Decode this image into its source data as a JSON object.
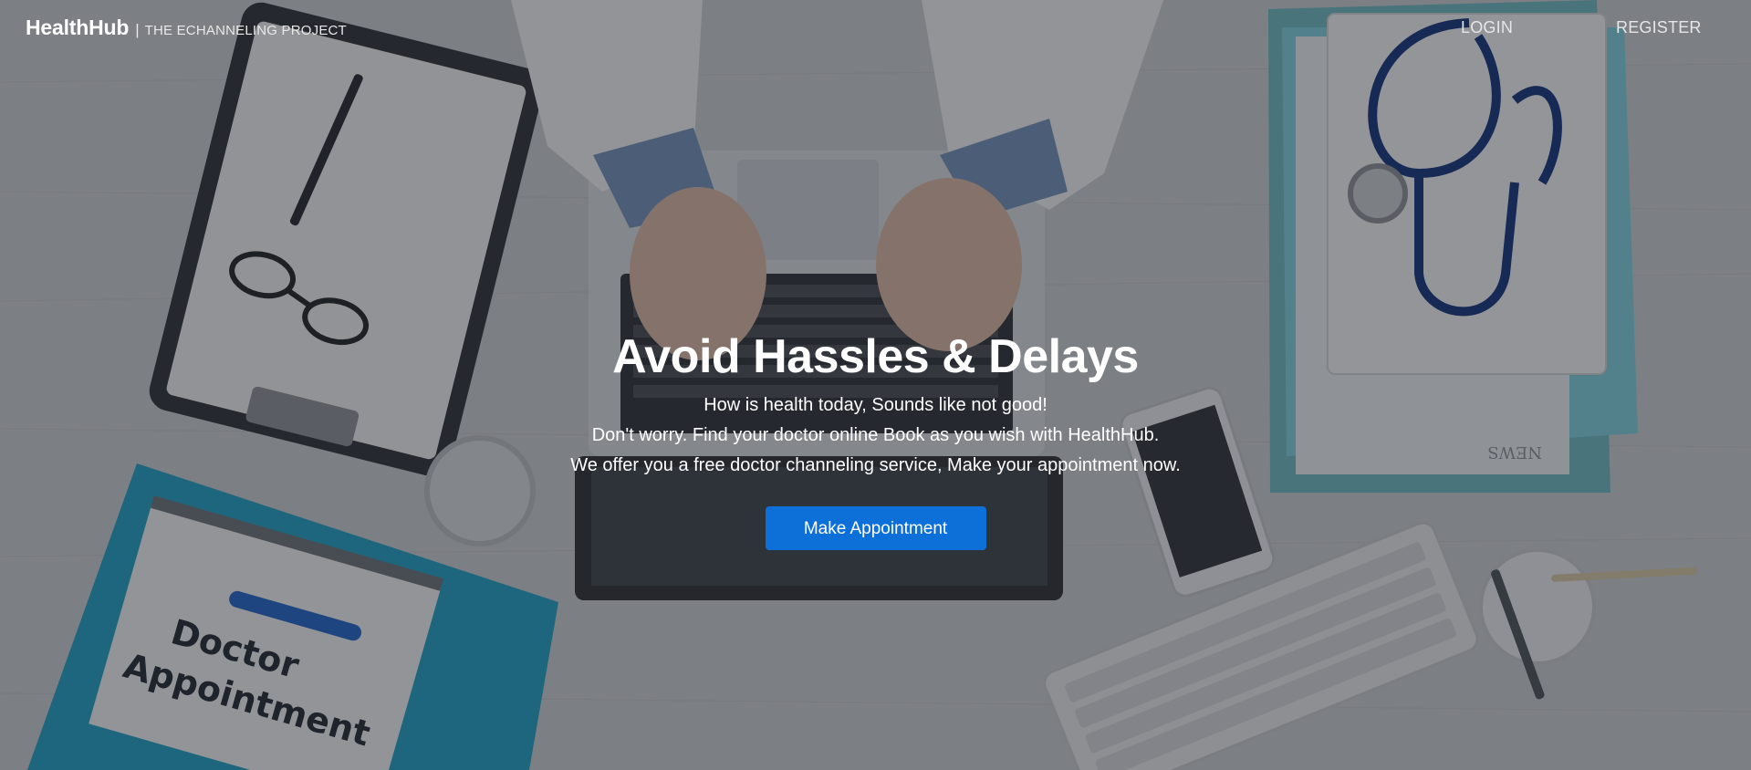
{
  "nav": {
    "brand_name": "HealthHub",
    "brand_separator": "|",
    "brand_tagline": "THE ECHANNELING PROJECT",
    "login_label": "LOGIN",
    "register_label": "REGISTER"
  },
  "hero": {
    "title": "Avoid Hassles & Delays",
    "lines": [
      "How is health today, Sounds like not good!",
      "Don't worry. Find your doctor online Book as you wish with HealthHub.",
      "We offer you a free doctor channeling service, Make your appointment now."
    ],
    "cta_label": "Make Appointment"
  },
  "background": {
    "notepad_text_line1": "Doctor",
    "notepad_text_line2": "Appointment",
    "paper_text": "NEWS"
  },
  "colors": {
    "primary_button": "#0d6fd8",
    "text": "#ffffff"
  }
}
